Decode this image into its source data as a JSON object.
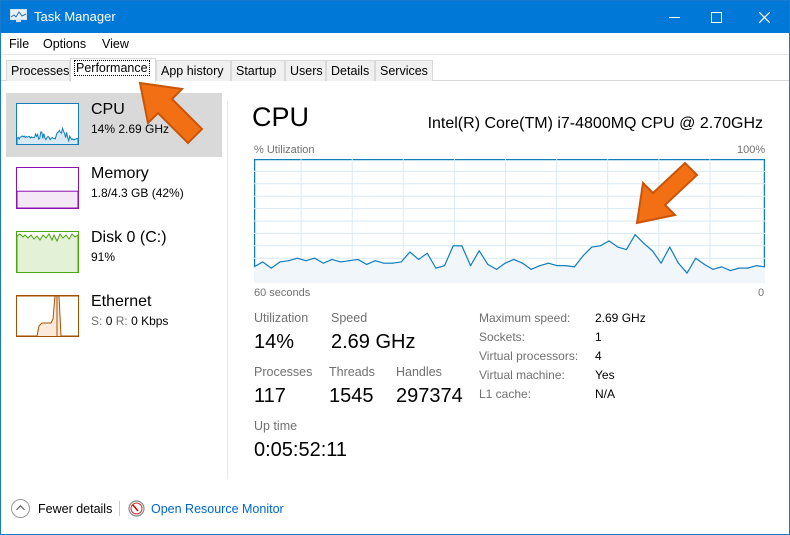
{
  "window": {
    "title": "Task Manager",
    "accent_color": "#0078d7",
    "controls": [
      "minimize",
      "maximize",
      "close"
    ]
  },
  "menu": [
    {
      "label": "File"
    },
    {
      "label": "Options"
    },
    {
      "label": "View"
    }
  ],
  "tabs": [
    {
      "label": "Processes",
      "active": false
    },
    {
      "label": "Performance",
      "active": true
    },
    {
      "label": "App history",
      "active": false
    },
    {
      "label": "Startup",
      "active": false
    },
    {
      "label": "Users",
      "active": false
    },
    {
      "label": "Details",
      "active": false
    },
    {
      "label": "Services",
      "active": false
    }
  ],
  "sidebar": {
    "items": [
      {
        "title": "CPU",
        "subtitle": "14% 2.69 GHz",
        "selected": true,
        "color": "#117dbb"
      },
      {
        "title": "Memory",
        "subtitle": "1.8/4.3 GB (42%)",
        "selected": false,
        "color": "#8b12ae",
        "usage_fraction": 0.42
      },
      {
        "title": "Disk 0 (C:)",
        "subtitle": "91%",
        "selected": false,
        "color": "#4da60c"
      },
      {
        "title": "Ethernet",
        "subtitle_s_label": "S:",
        "subtitle_s_value": "0",
        "subtitle_r_label": "R:",
        "subtitle_r_value": "0 Kbps",
        "selected": false,
        "color": "#a74f01"
      }
    ]
  },
  "main": {
    "title": "CPU",
    "model": "Intel(R) Core(TM) i7-4800MQ CPU @ 2.70GHz",
    "graph_label_left": "% Utilization",
    "graph_label_right": "100%",
    "graph_time_label": "60 seconds",
    "graph_min_label": "0",
    "stats": {
      "utilization_label": "Utilization",
      "utilization_value": "14%",
      "speed_label": "Speed",
      "speed_value": "2.69 GHz",
      "processes_label": "Processes",
      "processes_value": "117",
      "threads_label": "Threads",
      "threads_value": "1545",
      "handles_label": "Handles",
      "handles_value": "297374",
      "uptime_label": "Up time",
      "uptime_value": "0:05:52:11"
    },
    "details": [
      {
        "label": "Maximum speed:",
        "value": "2.69 GHz"
      },
      {
        "label": "Sockets:",
        "value": "1"
      },
      {
        "label": "Virtual processors:",
        "value": "4"
      },
      {
        "label": "Virtual machine:",
        "value": "Yes"
      },
      {
        "label": "L1 cache:",
        "value": "N/A"
      }
    ]
  },
  "footer": {
    "fewer_details": "Fewer details",
    "open_resource_monitor": "Open Resource Monitor"
  },
  "chart_data": {
    "type": "area",
    "title": "CPU % Utilization",
    "xlabel": "60 seconds",
    "ylabel": "% Utilization",
    "ylim": [
      0,
      100
    ],
    "xlim": [
      60,
      0
    ],
    "grid": true,
    "series": [
      {
        "name": "CPU",
        "color": "#117dbb",
        "values": [
          13,
          17,
          12,
          17,
          18,
          20,
          18,
          20,
          16,
          19,
          17,
          18,
          19,
          15,
          18,
          16,
          16,
          17,
          25,
          19,
          24,
          12,
          14,
          30,
          30,
          14,
          26,
          15,
          11,
          16,
          19,
          16,
          11,
          14,
          16,
          14,
          14,
          13,
          22,
          29,
          30,
          34,
          29,
          27,
          39,
          32,
          26,
          16,
          29,
          16,
          8,
          20,
          15,
          11,
          13,
          10,
          12,
          12,
          14,
          13
        ]
      }
    ]
  }
}
